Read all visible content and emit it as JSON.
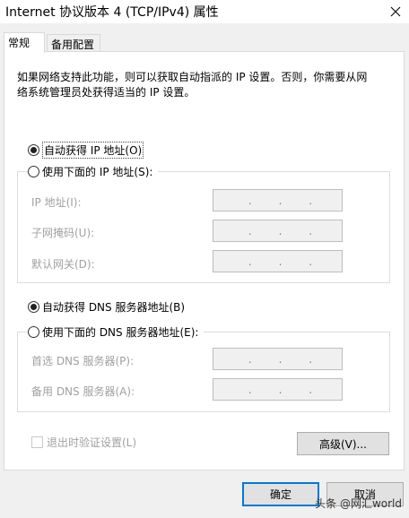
{
  "window": {
    "title": "Internet 协议版本 4 (TCP/IPv4) 属性"
  },
  "tabs": [
    {
      "label": "常规"
    },
    {
      "label": "备用配置"
    }
  ],
  "description": {
    "line1": "如果网络支持此功能，则可以获取自动指派的 IP 设置。否则，你需要从网",
    "line2": "络系统管理员处获得适当的 IP 设置。"
  },
  "ip_section": {
    "auto_label": "自动获得 IP 地址(O)",
    "manual_label": "使用下面的 IP 地址(S):",
    "auto_selected": true,
    "fields": [
      {
        "label": "IP 地址(I):"
      },
      {
        "label": "子网掩码(U):"
      },
      {
        "label": "默认网关(D):"
      }
    ]
  },
  "dns_section": {
    "auto_label": "自动获得 DNS 服务器地址(B)",
    "manual_label": "使用下面的 DNS 服务器地址(E):",
    "auto_selected": true,
    "fields": [
      {
        "label": "首选 DNS 服务器(P):"
      },
      {
        "label": "备用 DNS 服务器(A):"
      }
    ]
  },
  "ip_dot": ".",
  "validate_checkbox": {
    "label": "退出时验证设置(L)",
    "checked": false
  },
  "buttons": {
    "advanced": "高级(V)...",
    "ok": "确定",
    "cancel": "取消"
  },
  "watermark": "头条 @网汇world",
  "colors": {
    "accent": "#0078d7",
    "panel": "#ffffff",
    "window_bg": "#f0f0f0",
    "disabled_text": "#a0a0a0"
  },
  "icons": {
    "close": "close-icon"
  }
}
